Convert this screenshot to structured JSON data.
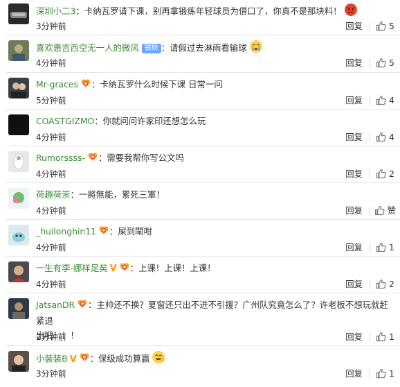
{
  "comments": [
    {
      "user": "深圳小二3",
      "sep": "：",
      "text": "卡纳瓦罗请下课，别再拿锻练年轻球员为借口了，你真不是那块料！",
      "time": "3分钟前",
      "reply": "回复",
      "likes": "5",
      "badge": "none",
      "tag": "",
      "emoji": "angry-emoji",
      "avatar_color": "#2a2a2a"
    },
    {
      "user": "喜欢惠吉西空无一人的微风",
      "sep": "：",
      "text": "请假过去淋雨看输球",
      "time": "4分钟前",
      "reply": "回复",
      "likes": "5",
      "badge": "none",
      "tag": "铁粉",
      "emoji": "crying-emoji",
      "avatar_color": "#6b7d55"
    },
    {
      "user": "Mr-graces",
      "sep": "：",
      "text": "卡纳瓦罗什么时候下课 日常一问",
      "time": "5分钟前",
      "reply": "回复",
      "likes": "4",
      "badge": "heart",
      "tag": "",
      "emoji": "",
      "avatar_color": "#3a3f46"
    },
    {
      "user": "COASTGIZMO",
      "sep": "：",
      "text": "你就问问许家印还想怎么玩",
      "time": "4分钟前",
      "reply": "回复",
      "likes": "4",
      "badge": "none",
      "tag": "",
      "emoji": "",
      "avatar_color": "#111111"
    },
    {
      "user": "Rumorssss-",
      "sep": "：",
      "text": "需要我帮你写公文吗",
      "time": "4分钟前",
      "reply": "回复",
      "likes": "2",
      "badge": "heart",
      "tag": "",
      "emoji": "",
      "avatar_color": "#e8e8e8"
    },
    {
      "user": "荷趣荷崇",
      "sep": "：",
      "text": "一將無能，累死三軍！",
      "time": "4分钟前",
      "reply": "回复",
      "likes": "赞",
      "badge": "none",
      "tag": "",
      "emoji": "",
      "avatar_color": "#eef3f6"
    },
    {
      "user": "_huilonghin11",
      "sep": "：",
      "text": "屎到閘咁",
      "time": "4分钟前",
      "reply": "回复",
      "likes": "1",
      "badge": "heart",
      "tag": "",
      "emoji": "",
      "avatar_color": "#dfe8ef"
    },
    {
      "user": "一生有李-娜样足矣",
      "sep": "：",
      "text": "上课！上课！上课！",
      "time": "4分钟前",
      "reply": "回复",
      "likes": "2",
      "badge": "vheart",
      "tag": "",
      "emoji": "",
      "avatar_color": "#4a4a52"
    },
    {
      "user": "JatsanDR",
      "sep": "：",
      "text": "主帅还不换？夏窗还只出不进不引援？广州队究竟怎么了？许老板不想玩就赶紧退",
      "text2": "出吧！！！",
      "time": "2分钟前",
      "reply": "回复",
      "likes": "1",
      "badge": "heart",
      "tag": "",
      "emoji": "",
      "avatar_color": "#2e3a4a"
    },
    {
      "user": "小装装B",
      "sep": "：",
      "text": "保级成功算赢",
      "time": "3分钟前",
      "reply": "回复",
      "likes": "1",
      "badge": "vheart",
      "tag": "",
      "emoji": "grin-emoji",
      "avatar_color": "#5a4f4a"
    }
  ]
}
